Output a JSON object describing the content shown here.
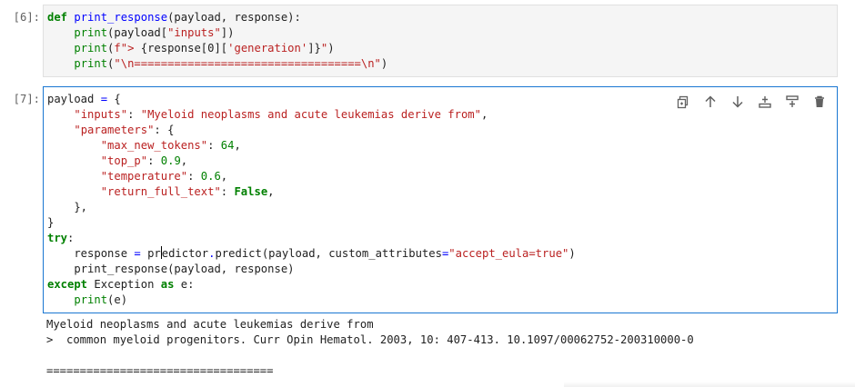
{
  "cells": [
    {
      "prompt": "[6]:",
      "lines": [
        [
          {
            "t": "def",
            "c": "kw"
          },
          {
            "t": " "
          },
          {
            "t": "print_response",
            "c": "fn"
          },
          {
            "t": "(payload, response):"
          }
        ],
        [
          {
            "t": "    "
          },
          {
            "t": "print",
            "c": "num"
          },
          {
            "t": "(payload["
          },
          {
            "t": "\"inputs\"",
            "c": "str"
          },
          {
            "t": "])"
          }
        ],
        [
          {
            "t": "    "
          },
          {
            "t": "print",
            "c": "num"
          },
          {
            "t": "("
          },
          {
            "t": "f\"> ",
            "c": "str"
          },
          {
            "t": "{response[0]["
          },
          {
            "t": "'generation'",
            "c": "str"
          },
          {
            "t": "]}"
          },
          {
            "t": "\"",
            "c": "str"
          },
          {
            "t": ")"
          }
        ],
        [
          {
            "t": "    "
          },
          {
            "t": "print",
            "c": "num"
          },
          {
            "t": "("
          },
          {
            "t": "\"\\n==================================\\n\"",
            "c": "str"
          },
          {
            "t": ")"
          }
        ]
      ]
    },
    {
      "prompt": "[7]:",
      "lines": [
        [
          {
            "t": "payload "
          },
          {
            "t": "=",
            "c": "fn"
          },
          {
            "t": " {"
          }
        ],
        [
          {
            "t": "    "
          },
          {
            "t": "\"inputs\"",
            "c": "str"
          },
          {
            "t": ": "
          },
          {
            "t": "\"Myeloid neoplasms and acute leukemias derive from\"",
            "c": "str"
          },
          {
            "t": ","
          }
        ],
        [
          {
            "t": "    "
          },
          {
            "t": "\"parameters\"",
            "c": "str"
          },
          {
            "t": ": {"
          }
        ],
        [
          {
            "t": "        "
          },
          {
            "t": "\"max_new_tokens\"",
            "c": "str"
          },
          {
            "t": ": "
          },
          {
            "t": "64",
            "c": "num"
          },
          {
            "t": ","
          }
        ],
        [
          {
            "t": "        "
          },
          {
            "t": "\"top_p\"",
            "c": "str"
          },
          {
            "t": ": "
          },
          {
            "t": "0.9",
            "c": "num"
          },
          {
            "t": ","
          }
        ],
        [
          {
            "t": "        "
          },
          {
            "t": "\"temperature\"",
            "c": "str"
          },
          {
            "t": ": "
          },
          {
            "t": "0.6",
            "c": "num"
          },
          {
            "t": ","
          }
        ],
        [
          {
            "t": "        "
          },
          {
            "t": "\"return_full_text\"",
            "c": "str"
          },
          {
            "t": ": "
          },
          {
            "t": "False",
            "c": "bool"
          },
          {
            "t": ","
          }
        ],
        [
          {
            "t": "    },"
          }
        ],
        [
          {
            "t": "}"
          }
        ],
        [
          {
            "t": "try",
            "c": "kw"
          },
          {
            "t": ":"
          }
        ],
        [
          {
            "t": "    response "
          },
          {
            "t": "=",
            "c": "fn"
          },
          {
            "t": " pr"
          },
          {
            "t": "",
            "c": "cursor"
          },
          {
            "t": "edictor"
          },
          {
            "t": ".",
            "c": "fn"
          },
          {
            "t": "predict(payload, custom_attributes"
          },
          {
            "t": "=",
            "c": "fn"
          },
          {
            "t": "\"accept_eula=true\"",
            "c": "str"
          },
          {
            "t": ")"
          }
        ],
        [
          {
            "t": "    "
          },
          {
            "t": "print_response(payload, response)"
          }
        ],
        [
          {
            "t": "except",
            "c": "kw"
          },
          {
            "t": " Exception "
          },
          {
            "t": "as",
            "c": "kw"
          },
          {
            "t": " e:"
          }
        ],
        [
          {
            "t": "    "
          },
          {
            "t": "print",
            "c": "num"
          },
          {
            "t": "(e)"
          }
        ]
      ],
      "output": [
        "Myeloid neoplasms and acute leukemias derive from",
        ">  common myeloid progenitors. Curr Opin Hematol. 2003, 10: 407-413. 10.1097/00062752-200310000-0",
        "",
        "=================================="
      ]
    }
  ],
  "toolbar": [
    {
      "name": "duplicate-cell-button",
      "icon": "duplicate-icon"
    },
    {
      "name": "move-up-button",
      "icon": "arrow-up-icon"
    },
    {
      "name": "move-down-button",
      "icon": "arrow-down-icon"
    },
    {
      "name": "insert-above-button",
      "icon": "insert-above-icon"
    },
    {
      "name": "insert-below-button",
      "icon": "insert-below-icon"
    },
    {
      "name": "delete-cell-button",
      "icon": "trash-icon"
    }
  ],
  "colors": {
    "active_border": "#1976d2",
    "keyword": "#008000",
    "string": "#ba2121",
    "function": "#0000ff",
    "icon": "#616161"
  }
}
